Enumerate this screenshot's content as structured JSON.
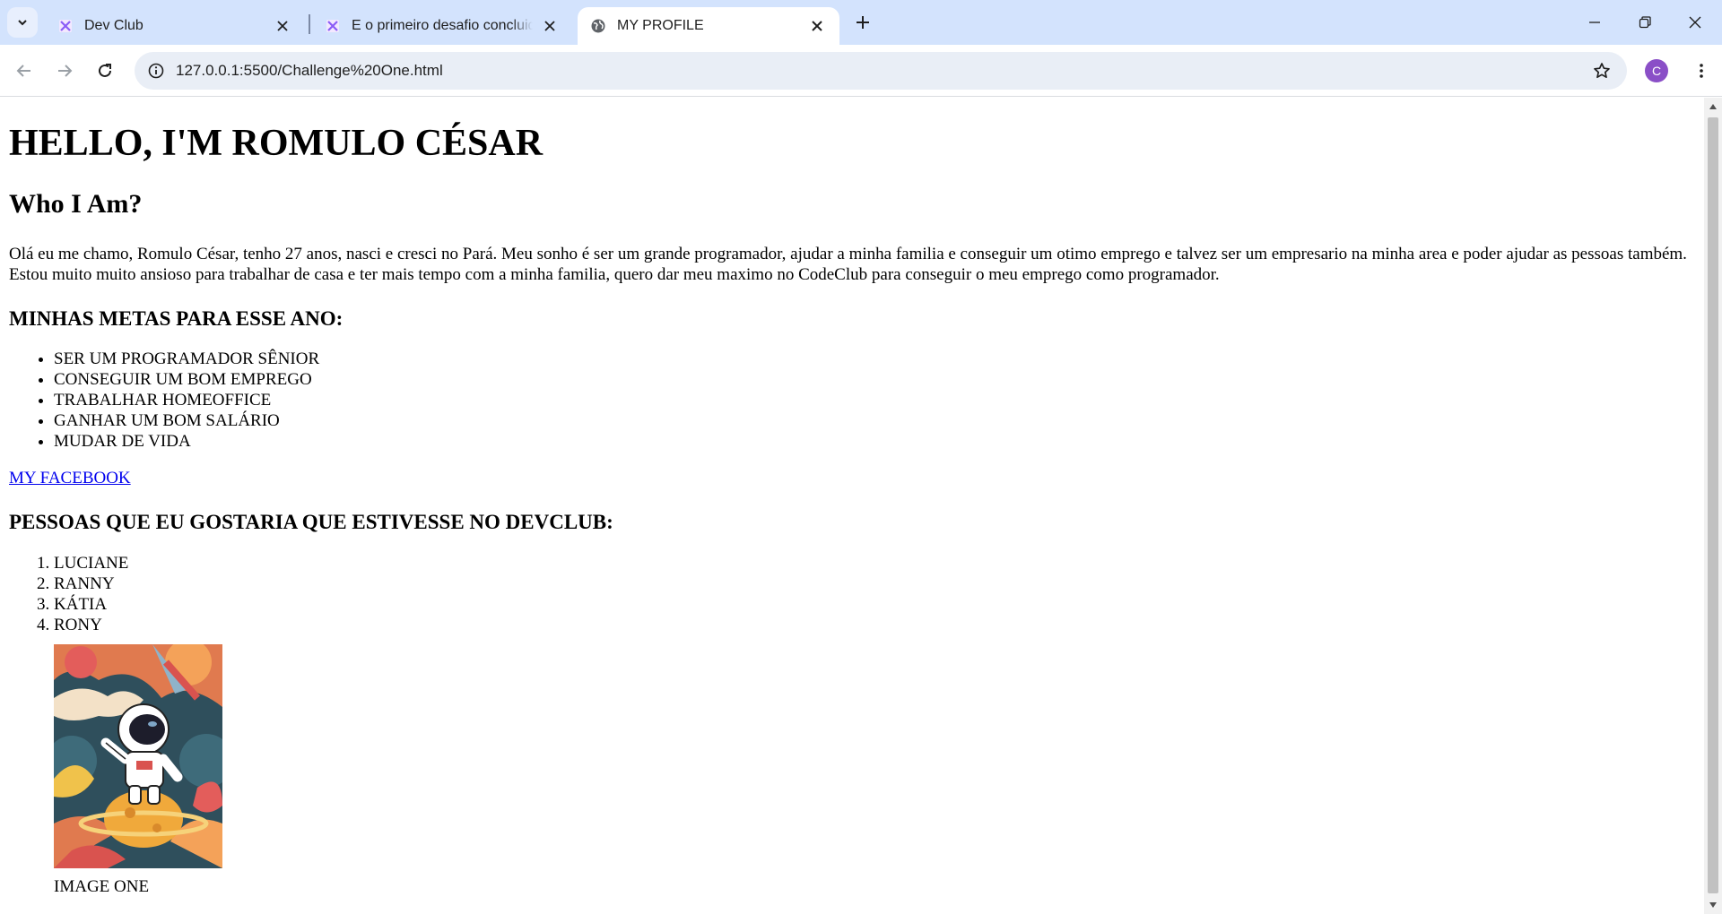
{
  "browser": {
    "tabs": [
      {
        "title": "Dev Club",
        "favicon": "devclub-icon"
      },
      {
        "title": "E o primeiro desafio concluido",
        "favicon": "devclub-icon"
      },
      {
        "title": "MY PROFILE",
        "favicon": "globe-icon",
        "active": true
      }
    ],
    "url": "127.0.0.1:5500/Challenge%20One.html",
    "profile_initial": "C"
  },
  "page": {
    "heading": "HELLO, I'M ROMULO CÉSAR",
    "about_title": "Who I Am?",
    "about_text": "Olá eu me chamo, Romulo César, tenho 27 anos, nasci e cresci no Pará. Meu sonho é ser um grande programador, ajudar a minha familia e conseguir um otimo emprego e talvez ser um empresario na minha area e poder ajudar as pessoas também. Estou muito muito ansioso para trabalhar de casa e ter mais tempo com a minha familia, quero dar meu maximo no CodeClub para conseguir o meu emprego como programador.",
    "goals_title": "MINHAS METAS PARA ESSE ANO:",
    "goals": [
      "SER UM PROGRAMADOR SÊNIOR",
      "CONSEGUIR UM BOM EMPREGO",
      "TRABALHAR HOMEOFFICE",
      "GANHAR UM BOM SALÁRIO",
      "MUDAR DE VIDA"
    ],
    "facebook_link": "MY FACEBOOK",
    "people_title": "PESSOAS QUE EU GOSTARIA QUE ESTIVESSE NO DEVCLUB:",
    "people": [
      "LUCIANE",
      "RANNY",
      "KÁTIA",
      "RONY"
    ],
    "image_caption": "IMAGE ONE",
    "image_subject": "astronaut-on-planet-illustration"
  },
  "colors": {
    "tabstrip": "#d3e3fd",
    "omnibox": "#e9eef6",
    "link": "#0000ee",
    "avatar": "#8a4fc7"
  }
}
